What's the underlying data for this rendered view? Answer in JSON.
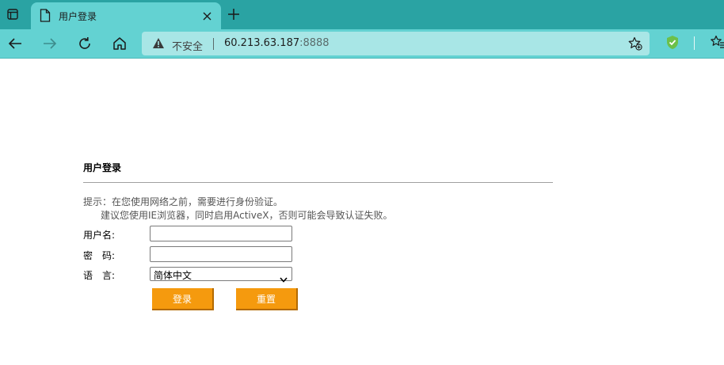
{
  "browser": {
    "tab": {
      "title": "用户登录"
    },
    "address_bar": {
      "security_label": "不安全",
      "host": "60.213.63.187",
      "port": ":8888"
    },
    "icons": {
      "window_menu": "window-icon",
      "tab_favicon": "document-icon",
      "tab_close": "close-icon",
      "new_tab": "plus-icon",
      "back": "back-arrow-icon",
      "forward": "forward-arrow-icon",
      "refresh": "refresh-icon",
      "home": "home-icon",
      "security": "warning-icon",
      "add_favorite": "star-add-icon",
      "extension": "shield-check-icon",
      "favorites": "favorites-icon"
    },
    "colors": {
      "tabbar": "#2aa3a3",
      "toolbar": "#63d2d2",
      "address_bar": "#a8e6e6"
    }
  },
  "page": {
    "heading": "用户登录",
    "hint_line1": "提示：在您使用网络之前，需要进行身份验证。",
    "hint_line2": "建议您使用IE浏览器，同时启用ActiveX，否则可能会导致认证失败。",
    "form": {
      "username_label": "用户名:",
      "username_value": "",
      "password_label": "密　码:",
      "password_value": "",
      "language_label": "语　言:",
      "language_selected": "简体中文"
    },
    "buttons": {
      "login": "登录",
      "reset": "重置"
    },
    "colors": {
      "button": "#f59a0e",
      "rule": "#a0a0a0"
    }
  }
}
